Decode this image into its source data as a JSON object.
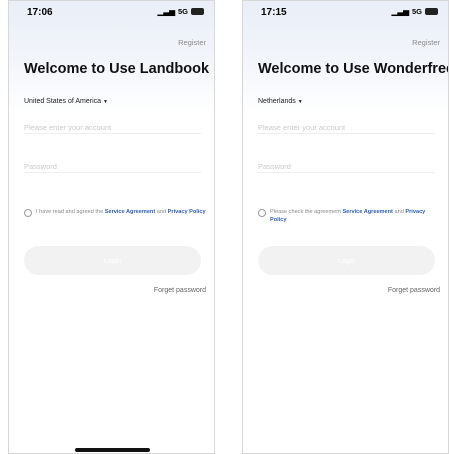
{
  "left": {
    "time": "17:06",
    "signal": "5G",
    "battery": "",
    "register": "Register",
    "title": "Welcome to Use Landbook",
    "country": "United States of America",
    "account_placeholder": "Please enter your account",
    "password_placeholder": "Password",
    "agree_prefix": "I have read and agreed the ",
    "agree_link1": "Service Agreement",
    "agree_mid": " and ",
    "agree_link2": "Privacy Policy",
    "login": "Login",
    "forget": "Forget password"
  },
  "right": {
    "time": "17:15",
    "signal": "5G",
    "battery": "",
    "register": "Register",
    "title": "Welcome to Use Wonderfree",
    "country": "Netherlands",
    "account_placeholder": "Please enter your account",
    "password_placeholder": "Password",
    "agree_prefix": "Please check the agreement ",
    "agree_link1": "Service Agreement",
    "agree_mid": " and ",
    "agree_link2": "Privacy Policy",
    "login": "Login",
    "forget": "Forget password"
  },
  "colors": {
    "link": "#2c5fbe",
    "login_bg": "#f2f2f2",
    "placeholder": "#c9c9c9"
  }
}
